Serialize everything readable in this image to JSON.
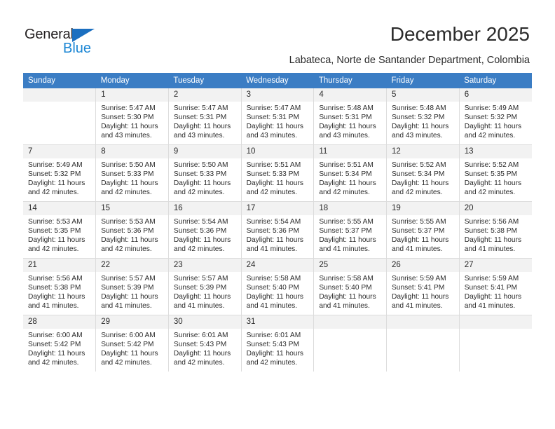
{
  "brand": {
    "name_part1": "General",
    "name_part2": "Blue",
    "triangle_color": "#1b6fc0",
    "blue_color": "#1b86d4"
  },
  "header": {
    "title": "December 2025",
    "subtitle": "Labateca, Norte de Santander Department, Colombia"
  },
  "theme": {
    "header_row_bg": "#3b7dc4",
    "daynum_bg": "#f2f2f2",
    "grid_line": "#dcdcdc",
    "text": "#2b2b2b"
  },
  "weekdays": [
    "Sunday",
    "Monday",
    "Tuesday",
    "Wednesday",
    "Thursday",
    "Friday",
    "Saturday"
  ],
  "labels": {
    "sunrise_prefix": "Sunrise:",
    "sunset_prefix": "Sunset:",
    "daylight_prefix": "Daylight:"
  },
  "weeks": [
    [
      {
        "day": "",
        "sunrise": "",
        "sunset": "",
        "daylight": ""
      },
      {
        "day": "1",
        "sunrise": "Sunrise: 5:47 AM",
        "sunset": "Sunset: 5:30 PM",
        "daylight": "Daylight: 11 hours and 43 minutes."
      },
      {
        "day": "2",
        "sunrise": "Sunrise: 5:47 AM",
        "sunset": "Sunset: 5:31 PM",
        "daylight": "Daylight: 11 hours and 43 minutes."
      },
      {
        "day": "3",
        "sunrise": "Sunrise: 5:47 AM",
        "sunset": "Sunset: 5:31 PM",
        "daylight": "Daylight: 11 hours and 43 minutes."
      },
      {
        "day": "4",
        "sunrise": "Sunrise: 5:48 AM",
        "sunset": "Sunset: 5:31 PM",
        "daylight": "Daylight: 11 hours and 43 minutes."
      },
      {
        "day": "5",
        "sunrise": "Sunrise: 5:48 AM",
        "sunset": "Sunset: 5:32 PM",
        "daylight": "Daylight: 11 hours and 43 minutes."
      },
      {
        "day": "6",
        "sunrise": "Sunrise: 5:49 AM",
        "sunset": "Sunset: 5:32 PM",
        "daylight": "Daylight: 11 hours and 42 minutes."
      }
    ],
    [
      {
        "day": "7",
        "sunrise": "Sunrise: 5:49 AM",
        "sunset": "Sunset: 5:32 PM",
        "daylight": "Daylight: 11 hours and 42 minutes."
      },
      {
        "day": "8",
        "sunrise": "Sunrise: 5:50 AM",
        "sunset": "Sunset: 5:33 PM",
        "daylight": "Daylight: 11 hours and 42 minutes."
      },
      {
        "day": "9",
        "sunrise": "Sunrise: 5:50 AM",
        "sunset": "Sunset: 5:33 PM",
        "daylight": "Daylight: 11 hours and 42 minutes."
      },
      {
        "day": "10",
        "sunrise": "Sunrise: 5:51 AM",
        "sunset": "Sunset: 5:33 PM",
        "daylight": "Daylight: 11 hours and 42 minutes."
      },
      {
        "day": "11",
        "sunrise": "Sunrise: 5:51 AM",
        "sunset": "Sunset: 5:34 PM",
        "daylight": "Daylight: 11 hours and 42 minutes."
      },
      {
        "day": "12",
        "sunrise": "Sunrise: 5:52 AM",
        "sunset": "Sunset: 5:34 PM",
        "daylight": "Daylight: 11 hours and 42 minutes."
      },
      {
        "day": "13",
        "sunrise": "Sunrise: 5:52 AM",
        "sunset": "Sunset: 5:35 PM",
        "daylight": "Daylight: 11 hours and 42 minutes."
      }
    ],
    [
      {
        "day": "14",
        "sunrise": "Sunrise: 5:53 AM",
        "sunset": "Sunset: 5:35 PM",
        "daylight": "Daylight: 11 hours and 42 minutes."
      },
      {
        "day": "15",
        "sunrise": "Sunrise: 5:53 AM",
        "sunset": "Sunset: 5:36 PM",
        "daylight": "Daylight: 11 hours and 42 minutes."
      },
      {
        "day": "16",
        "sunrise": "Sunrise: 5:54 AM",
        "sunset": "Sunset: 5:36 PM",
        "daylight": "Daylight: 11 hours and 42 minutes."
      },
      {
        "day": "17",
        "sunrise": "Sunrise: 5:54 AM",
        "sunset": "Sunset: 5:36 PM",
        "daylight": "Daylight: 11 hours and 41 minutes."
      },
      {
        "day": "18",
        "sunrise": "Sunrise: 5:55 AM",
        "sunset": "Sunset: 5:37 PM",
        "daylight": "Daylight: 11 hours and 41 minutes."
      },
      {
        "day": "19",
        "sunrise": "Sunrise: 5:55 AM",
        "sunset": "Sunset: 5:37 PM",
        "daylight": "Daylight: 11 hours and 41 minutes."
      },
      {
        "day": "20",
        "sunrise": "Sunrise: 5:56 AM",
        "sunset": "Sunset: 5:38 PM",
        "daylight": "Daylight: 11 hours and 41 minutes."
      }
    ],
    [
      {
        "day": "21",
        "sunrise": "Sunrise: 5:56 AM",
        "sunset": "Sunset: 5:38 PM",
        "daylight": "Daylight: 11 hours and 41 minutes."
      },
      {
        "day": "22",
        "sunrise": "Sunrise: 5:57 AM",
        "sunset": "Sunset: 5:39 PM",
        "daylight": "Daylight: 11 hours and 41 minutes."
      },
      {
        "day": "23",
        "sunrise": "Sunrise: 5:57 AM",
        "sunset": "Sunset: 5:39 PM",
        "daylight": "Daylight: 11 hours and 41 minutes."
      },
      {
        "day": "24",
        "sunrise": "Sunrise: 5:58 AM",
        "sunset": "Sunset: 5:40 PM",
        "daylight": "Daylight: 11 hours and 41 minutes."
      },
      {
        "day": "25",
        "sunrise": "Sunrise: 5:58 AM",
        "sunset": "Sunset: 5:40 PM",
        "daylight": "Daylight: 11 hours and 41 minutes."
      },
      {
        "day": "26",
        "sunrise": "Sunrise: 5:59 AM",
        "sunset": "Sunset: 5:41 PM",
        "daylight": "Daylight: 11 hours and 41 minutes."
      },
      {
        "day": "27",
        "sunrise": "Sunrise: 5:59 AM",
        "sunset": "Sunset: 5:41 PM",
        "daylight": "Daylight: 11 hours and 41 minutes."
      }
    ],
    [
      {
        "day": "28",
        "sunrise": "Sunrise: 6:00 AM",
        "sunset": "Sunset: 5:42 PM",
        "daylight": "Daylight: 11 hours and 42 minutes."
      },
      {
        "day": "29",
        "sunrise": "Sunrise: 6:00 AM",
        "sunset": "Sunset: 5:42 PM",
        "daylight": "Daylight: 11 hours and 42 minutes."
      },
      {
        "day": "30",
        "sunrise": "Sunrise: 6:01 AM",
        "sunset": "Sunset: 5:43 PM",
        "daylight": "Daylight: 11 hours and 42 minutes."
      },
      {
        "day": "31",
        "sunrise": "Sunrise: 6:01 AM",
        "sunset": "Sunset: 5:43 PM",
        "daylight": "Daylight: 11 hours and 42 minutes."
      },
      {
        "day": "",
        "sunrise": "",
        "sunset": "",
        "daylight": ""
      },
      {
        "day": "",
        "sunrise": "",
        "sunset": "",
        "daylight": ""
      },
      {
        "day": "",
        "sunrise": "",
        "sunset": "",
        "daylight": ""
      }
    ]
  ]
}
